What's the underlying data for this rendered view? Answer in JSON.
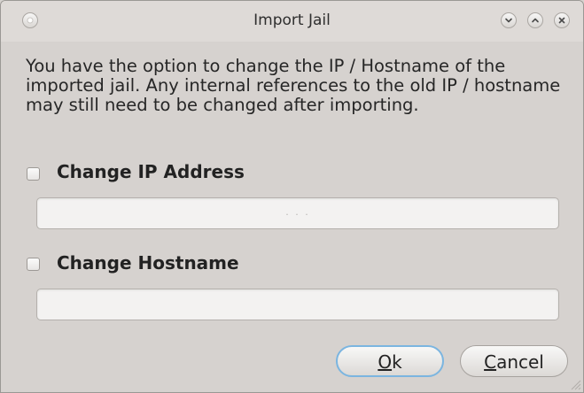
{
  "window": {
    "title": "Import Jail"
  },
  "dialog": {
    "description": "You have the option to change the IP / Hostname of the imported jail. Any internal references to the old IP / hostname may still need to be changed after importing.",
    "change_ip": {
      "label": "Change IP Address",
      "checked": false,
      "input_value": "",
      "input_mask": ". . ."
    },
    "change_hostname": {
      "label": "Change Hostname",
      "checked": false,
      "input_value": ""
    }
  },
  "buttons": {
    "ok_accel": "O",
    "ok_rest": "k",
    "cancel_accel": "C",
    "cancel_rest": "ancel"
  },
  "colors": {
    "window_bg": "#d6d2cf",
    "default_button_border": "#7bb5e0"
  }
}
